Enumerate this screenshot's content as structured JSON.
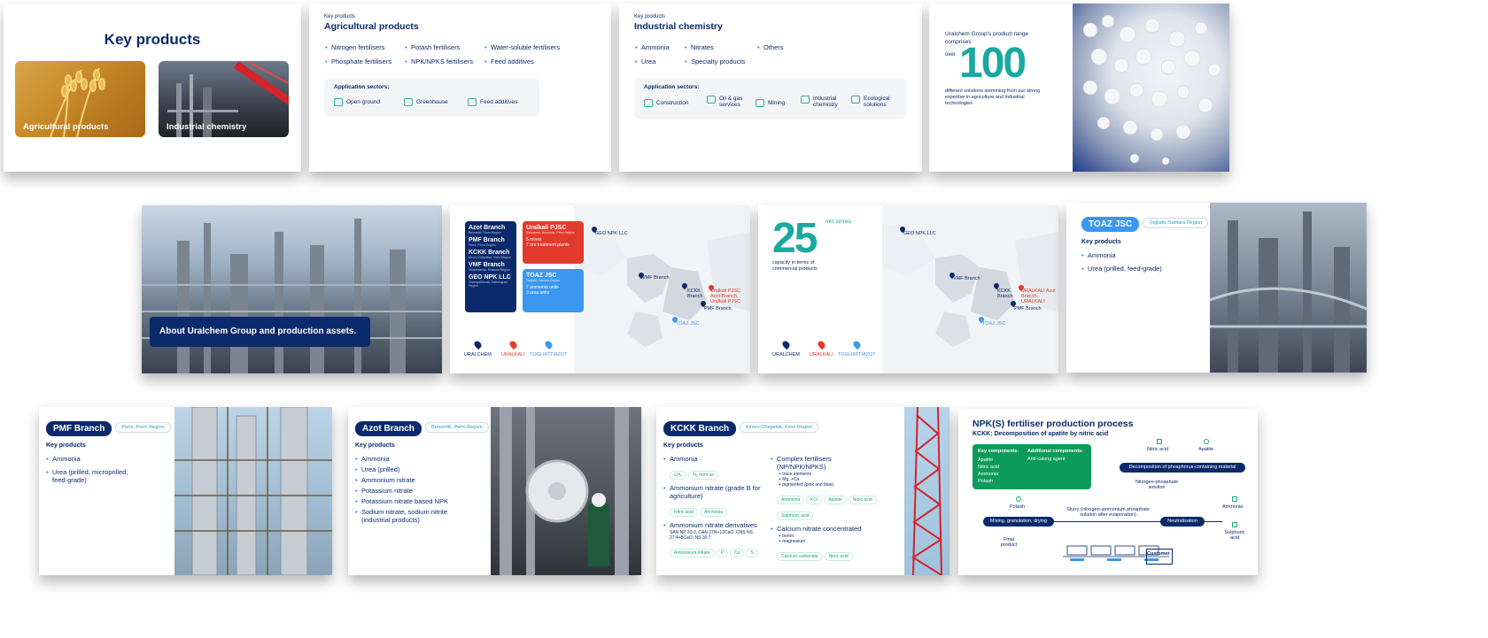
{
  "s1": {
    "title": "Key products",
    "card_agri": "Agricultural products",
    "card_ind": "Industrial chemistry"
  },
  "s2": {
    "eyebrow": "Key products",
    "title": "Agricultural products",
    "items": [
      "Nitrogen fertilisers",
      "Potash fertilisers",
      "Water-soluble fertilisers",
      "Phosphate fertilisers",
      "NPK/NPKS fertilisers",
      "Feed additives"
    ],
    "sectors_label": "Application sectors:",
    "sectors": [
      "Open ground",
      "Greenhouse",
      "Feed additives"
    ]
  },
  "s3": {
    "eyebrow": "Key products",
    "title": "Industrial chemistry",
    "items": [
      "Ammonia",
      "Nitrates",
      "Others",
      "Urea",
      "Specialty products"
    ],
    "sectors_label": "Application sectors:",
    "sectors": [
      "Construction",
      "Oil & gas services",
      "Mining",
      "Industrial chemistry",
      "Ecological solutions"
    ]
  },
  "s4": {
    "line1": "Uralchem Group's product range comprises",
    "over": "over",
    "number": "100",
    "desc": "different solutions stemming from our strong expertise in agriculture and industrial technologies"
  },
  "s5": {
    "caption": "About Uralchem Group and production assets."
  },
  "s6": {
    "blue_box": [
      {
        "name": "Azot Branch",
        "region": "Berezniki, Perm Region"
      },
      {
        "name": "PMF Branch",
        "region": "Perm, Perm Region"
      },
      {
        "name": "KCKK Branch",
        "region": "Kirovo-Chepetsk, Kirov Region"
      },
      {
        "name": "VMF Branch",
        "region": "Voskresensk, Moscow Region"
      },
      {
        "name": "GEO NPK LLC",
        "region": "Chernyakhovsk, Kaliningrad Region"
      }
    ],
    "red_box": {
      "name": "Uralkali PJSC",
      "region": "Solikamsk, Berezniki, Perm Region",
      "l1": "5 mines",
      "l2": "7 ore treatment plants"
    },
    "lblue_box": {
      "name": "TOAZ JSC",
      "region": "Togliatti, Samara Region",
      "l1": "7 ammonia units",
      "l2": "3 urea units"
    },
    "map_labels": [
      "GEO NPK LLC",
      "VMF Branch",
      "KCKK Branch",
      "Uralkali PJSC Azot Branch, Uralkali PJSC",
      "PMF Branch",
      "TOAZ JSC"
    ],
    "legend": [
      "URALCHEM",
      "URALKALI",
      "TOGLIATTIAZOT"
    ]
  },
  "s7": {
    "number": "25",
    "unit": "mln tonnes",
    "desc": "capacity in terms of commercial products",
    "map_labels": [
      "GEO NPK LLC",
      "VMF Branch",
      "KCKK Branch",
      "URALKALI Azot Branch, URALKALI",
      "PMF Branch",
      "TOAZ JSC"
    ],
    "legend": [
      "URALCHEM",
      "URALKALI",
      "TOGLIATTIAZOT"
    ]
  },
  "s8": {
    "badge": "TOAZ JSC",
    "region": "Togliatti, Samara Region",
    "kp": "Key products",
    "items": [
      "Ammonia",
      "Urea (prilled, feed-grade)"
    ]
  },
  "s9": {
    "badge": "PMF Branch",
    "region": "Perm, Perm Region",
    "kp": "Key products",
    "items": [
      "Ammonia",
      "Urea (prilled, microprilled, feed-grade)"
    ]
  },
  "s10": {
    "badge": "Azot Branch",
    "region": "Berezniki, Perm Region",
    "kp": "Key products",
    "items": [
      "Ammonia",
      "Urea (prilled)",
      "Ammonium nitrate",
      "Potassium nitrate",
      "Potassium nitrate based NPK",
      "Sodium nitrate, sodium nitrite (industrial products)"
    ]
  },
  "s11": {
    "badge": "KCKK Branch",
    "region": "Kirovo-Chepetsk, Kirov Region",
    "kp": "Key products",
    "left": [
      {
        "title": "Ammonia",
        "sub": "",
        "pills": [
          "CH₄",
          "N₂ from air"
        ]
      },
      {
        "title": "Ammonium nitrate (grade B for agriculture)",
        "sub": "",
        "pills": [
          "Nitric acid",
          "Ammonia"
        ]
      },
      {
        "title": "Ammonium nitrate derivatives",
        "sub": "SAN NP 33:3, CAN 27N+12CaO, CNS NS 27:4+8CaO, NS 30:7",
        "pills": [
          "Ammonium nitrate",
          "P",
          "Ca",
          "S"
        ]
      }
    ],
    "right": [
      {
        "title": "Complex fertilisers (NP/NPK/NPKS)",
        "subs": [
          "+ trace elements",
          "+ Mg, +Ca",
          "+ pigmented (pink and blue)"
        ],
        "pills": [
          "Ammonia",
          "KCl",
          "Apatite",
          "Nitric acid",
          "Sulphuric acid"
        ]
      },
      {
        "title": "Calcium nitrate concentrated",
        "subs": [
          "+ boron",
          "+ magnesium"
        ],
        "pills": [
          "Calcium carbonate",
          "Nitric acid"
        ]
      }
    ]
  },
  "s12": {
    "title": "NPK(S) fertiliser production process",
    "subtitle": "KCKK: Decomposition of apatite by nitric acid",
    "key_label": "Key components:",
    "key_items": [
      "Apatite",
      "Nitric acid",
      "Ammonia",
      "Potash"
    ],
    "add_label": "Additional components:",
    "add_items": [
      "Anti-caking agent"
    ],
    "nitric": "Nitric acid",
    "apatite": "Apatite",
    "decomp": "Decomposition of phosphorus-containing material",
    "np_solution": "Nitrogen-phosphate solution",
    "potash": "Potash",
    "slurry": "Slurry (nitrogen-ammonium phosphate solution after evaporation)",
    "ammonia": "Ammonia",
    "mixing": "Mixing, granulation, drying",
    "neutral": "Neutralisation",
    "sulphuric": "Sulphuric acid",
    "final": "Final product",
    "customer": "Customer"
  },
  "colors": {
    "navy": "#0b2a6b",
    "teal": "#1aa37a",
    "red": "#e23b2e",
    "lightblue": "#3b97f0",
    "green": "#0d9b5b"
  }
}
